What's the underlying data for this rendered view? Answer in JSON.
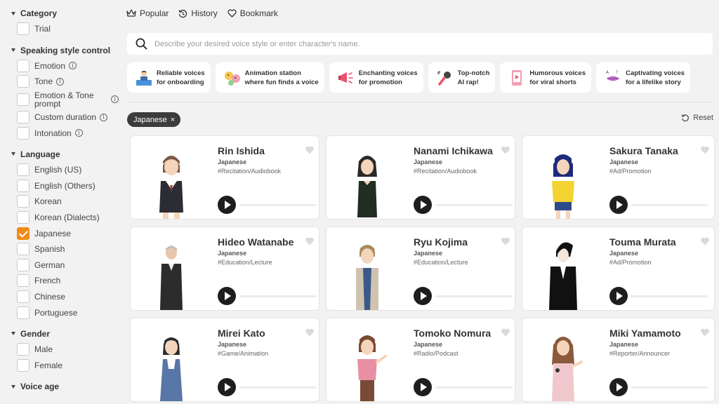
{
  "sidebar": {
    "sections": {
      "category": {
        "title": "Category",
        "items": [
          "Trial"
        ]
      },
      "style": {
        "title": "Speaking style control",
        "items": [
          "Emotion",
          "Tone",
          "Emotion & Tone prompt",
          "Custom duration",
          "Intonation"
        ]
      },
      "language": {
        "title": "Language",
        "items": [
          "English (US)",
          "English (Others)",
          "Korean",
          "Korean (Dialects)",
          "Japanese",
          "Spanish",
          "German",
          "French",
          "Chinese",
          "Portuguese"
        ],
        "checked": "Japanese"
      },
      "gender": {
        "title": "Gender",
        "items": [
          "Male",
          "Female"
        ]
      },
      "age": {
        "title": "Voice age"
      }
    }
  },
  "tabs": [
    {
      "label": "Popular",
      "icon": "crown-icon"
    },
    {
      "label": "History",
      "icon": "history-icon"
    },
    {
      "label": "Bookmark",
      "icon": "heart-outline-icon"
    }
  ],
  "search": {
    "placeholder": "Describe your desired voice style or enter character's name."
  },
  "chips": [
    {
      "line1": "Reliable voices",
      "line2": "for onboarding"
    },
    {
      "line1": "Animation station",
      "line2": "where fun finds a voice"
    },
    {
      "line1": "Enchanting voices",
      "line2": "for promotion"
    },
    {
      "line1": "Top-notch",
      "line2": "AI rap!"
    },
    {
      "line1": "Humorous voices",
      "line2": "for viral shorts"
    },
    {
      "line1": "Captivating voices",
      "line2": "for a lifelike story"
    }
  ],
  "filter": {
    "tag": "Japanese",
    "remove": "×",
    "reset": "Reset"
  },
  "voices": [
    {
      "name": "Rin Ishida",
      "lang": "Japanese",
      "tag": "#Recitation/Audiobook"
    },
    {
      "name": "Nanami Ichikawa",
      "lang": "Japanese",
      "tag": "#Recitation/Audiobook"
    },
    {
      "name": "Sakura Tanaka",
      "lang": "Japanese",
      "tag": "#Ad/Promotion"
    },
    {
      "name": "Hideo Watanabe",
      "lang": "Japanese",
      "tag": "#Education/Lecture"
    },
    {
      "name": "Ryu Kojima",
      "lang": "Japanese",
      "tag": "#Education/Lecture"
    },
    {
      "name": "Touma Murata",
      "lang": "Japanese",
      "tag": "#Ad/Promotion"
    },
    {
      "name": "Mirei Kato",
      "lang": "Japanese",
      "tag": "#Game/Animation"
    },
    {
      "name": "Tomoko Nomura",
      "lang": "Japanese",
      "tag": "#Radio/Podcast"
    },
    {
      "name": "Miki Yamamoto",
      "lang": "Japanese",
      "tag": "#Reporter/Announcer"
    }
  ],
  "colors": {
    "accent": "#f08a18",
    "dark": "#1e1e1e",
    "background": "#f2f2f2"
  }
}
